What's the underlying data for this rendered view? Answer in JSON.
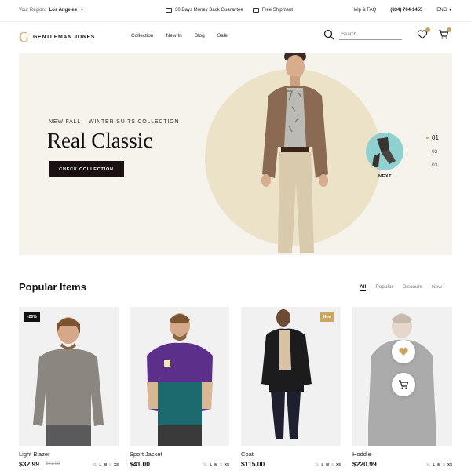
{
  "topbar": {
    "region_label": "Your Region:",
    "region_value": "Los Angeles",
    "promo1": "30 Days Money Back Guarantee",
    "promo2": "Free Shipment",
    "help": "Help & FAQ",
    "phone": "(834) 704-1455",
    "language": "ENG"
  },
  "header": {
    "logo_mark": "G",
    "brand": "GENTLEMAN JONES",
    "nav": [
      "Collection",
      "New In",
      "Blog",
      "Sale"
    ],
    "search_placeholder": "Search",
    "icons": [
      "search-icon",
      "heart-icon",
      "cart-icon"
    ]
  },
  "hero": {
    "subtitle": "NEW FALL – WINTER SUITS COLLECTION",
    "title": "Real Classic",
    "cta": "CHECK COLLECTION",
    "next_label": "NEXT",
    "pages": [
      "01",
      "02",
      "03"
    ],
    "active_page": "01"
  },
  "popular": {
    "title": "Popular Items",
    "filters": [
      "All",
      "Popular",
      "Discount",
      "New"
    ],
    "active_filter": "All",
    "products": [
      {
        "name": "Light Blazer",
        "price": "$32.99",
        "old_price": "$41.99",
        "tag": "-20%",
        "sizes": [
          "XL",
          "L",
          "M",
          "S",
          "XS"
        ]
      },
      {
        "name": "Sport Jacket",
        "price": "$41.00",
        "tag": "",
        "sizes": [
          "XL",
          "L",
          "M",
          "S",
          "XS"
        ]
      },
      {
        "name": "Coat",
        "price": "$115.00",
        "tag": "New",
        "sizes": [
          "XL",
          "L",
          "M",
          "S",
          "XS"
        ]
      },
      {
        "name": "Hoddie",
        "price": "$220.99",
        "tag": "",
        "sizes": [
          "XL",
          "L",
          "M",
          "S",
          "XS"
        ]
      }
    ]
  },
  "colors": {
    "accent": "#c9a55f",
    "hero_bg": "#f6f3ec",
    "circle": "#ebe2c8",
    "dark": "#1a1212"
  }
}
